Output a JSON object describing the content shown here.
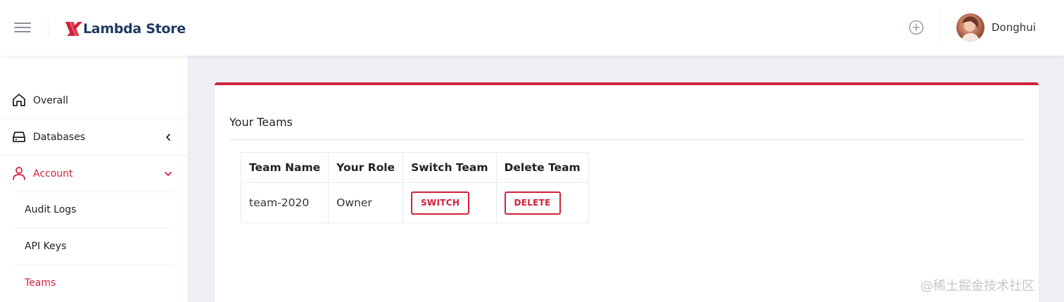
{
  "header": {
    "brand_name": "Lambda Store",
    "user_name": "Donghui",
    "brand_color": "#d0213a",
    "icons": [
      "hamburger-menu-icon",
      "lambda-logo-icon",
      "add-circle-icon",
      "user-avatar"
    ]
  },
  "sidebar": {
    "items": [
      {
        "label": "Overall",
        "icon": "home-icon"
      },
      {
        "label": "Databases",
        "icon": "database-icon",
        "chevron": "chevron-left-icon"
      },
      {
        "label": "Account",
        "icon": "user-icon",
        "chevron": "chevron-down-icon",
        "active": true
      }
    ],
    "sub_items": [
      {
        "label": "Audit Logs"
      },
      {
        "label": "API Keys"
      },
      {
        "label": "Teams",
        "active": true
      }
    ]
  },
  "main": {
    "title": "Your Teams",
    "table": {
      "columns": [
        "Team Name",
        "Your Role",
        "Switch Team",
        "Delete Team"
      ],
      "rows": [
        {
          "team_name": "team-2020",
          "role": "Owner",
          "switch_label": "SWITCH",
          "delete_label": "DELETE"
        }
      ]
    }
  },
  "watermark": "@稀土掘金技术社区"
}
